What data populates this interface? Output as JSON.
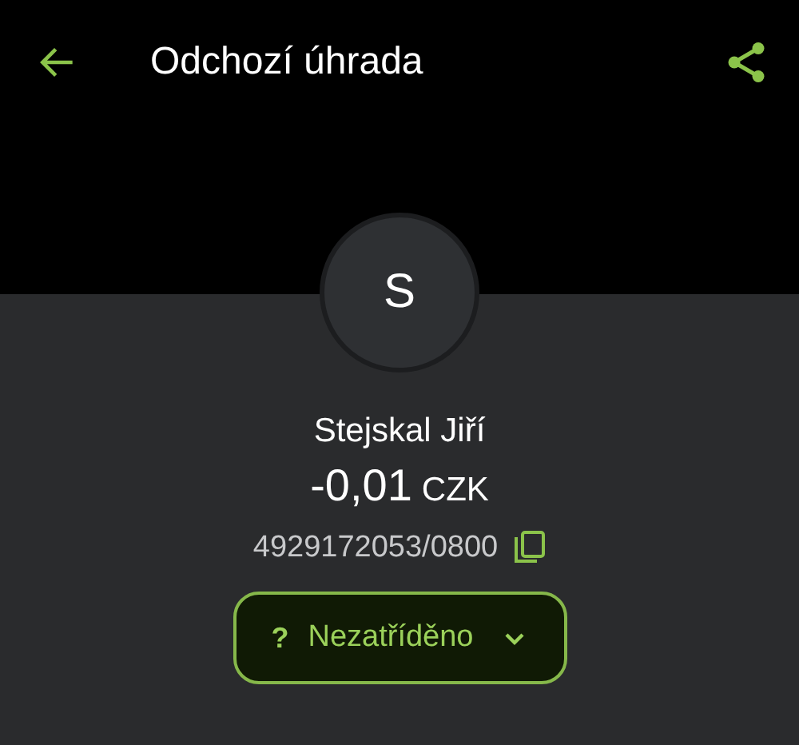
{
  "header": {
    "title": "Odchozí úhrada"
  },
  "avatar": {
    "initial": "S"
  },
  "payee": {
    "name": "Stejskal Jiří",
    "amount": "-0,01",
    "currency": "CZK",
    "account": "4929172053/0800"
  },
  "category": {
    "icon": "?",
    "label": "Nezatříděno"
  }
}
